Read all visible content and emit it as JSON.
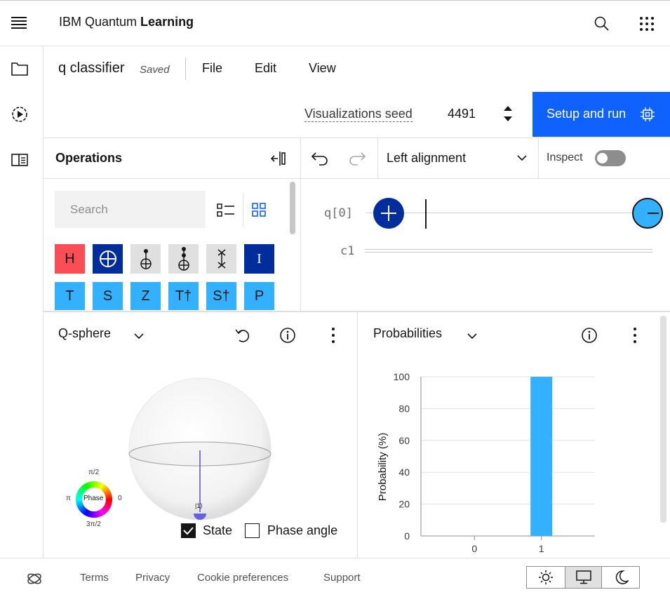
{
  "header": {
    "brand_prefix": "IBM Quantum ",
    "brand_bold": "Learning"
  },
  "composer": {
    "file_name": "q classifier",
    "saved_status": "Saved",
    "menu": [
      "File",
      "Edit",
      "View"
    ],
    "seed_label": "Visualizations seed",
    "seed_value": "4491",
    "run_button": "Setup and run"
  },
  "operations": {
    "title": "Operations",
    "search_placeholder": "Search",
    "gates_row1": [
      {
        "label": "H",
        "style": "red"
      },
      {
        "label": "",
        "style": "dark",
        "icon": "cnot-target-icon"
      },
      {
        "label": "",
        "style": "grey",
        "icon": "cnot-icon"
      },
      {
        "label": "",
        "style": "grey",
        "icon": "toffoli-icon"
      },
      {
        "label": "",
        "style": "grey",
        "icon": "swap-icon"
      },
      {
        "label": "I",
        "style": "dark"
      }
    ],
    "gates_row2": [
      {
        "label": "T",
        "style": "blue"
      },
      {
        "label": "S",
        "style": "blue"
      },
      {
        "label": "Z",
        "style": "blue"
      },
      {
        "label": "T†",
        "style": "blue"
      },
      {
        "label": "S†",
        "style": "blue"
      },
      {
        "label": "P",
        "style": "blue"
      }
    ]
  },
  "circuit": {
    "alignment": "Left alignment",
    "inspect_label": "Inspect",
    "qubit_label": "q[0]",
    "classical_label": "c1"
  },
  "qsphere": {
    "title": "Q-sphere",
    "state_label": "|1⟩",
    "phase_label": "Phase",
    "phase_top": "π/2",
    "phase_left": "π",
    "phase_right": "0",
    "phase_bottom": "3π/2",
    "checkbox_state": "State",
    "checkbox_phase": "Phase angle"
  },
  "probabilities": {
    "title": "Probabilities",
    "ylabel": "Probability (%)"
  },
  "chart_data": {
    "type": "bar",
    "categories": [
      "0",
      "1"
    ],
    "values": [
      0,
      100
    ],
    "title": "",
    "xlabel": "",
    "ylabel": "Probability (%)",
    "ylim": [
      0,
      100
    ],
    "yticks": [
      "0",
      "20",
      "40",
      "60",
      "80",
      "100"
    ],
    "bar_color": "#33b1ff",
    "grid": true
  },
  "footer": {
    "links": [
      "Terms",
      "Privacy",
      "Cookie preferences",
      "Support"
    ]
  },
  "colors": {
    "accent": "#0f62fe",
    "gate_blue": "#33b1ff",
    "gate_dark": "#002d9c",
    "gate_red": "#fa4d56"
  }
}
